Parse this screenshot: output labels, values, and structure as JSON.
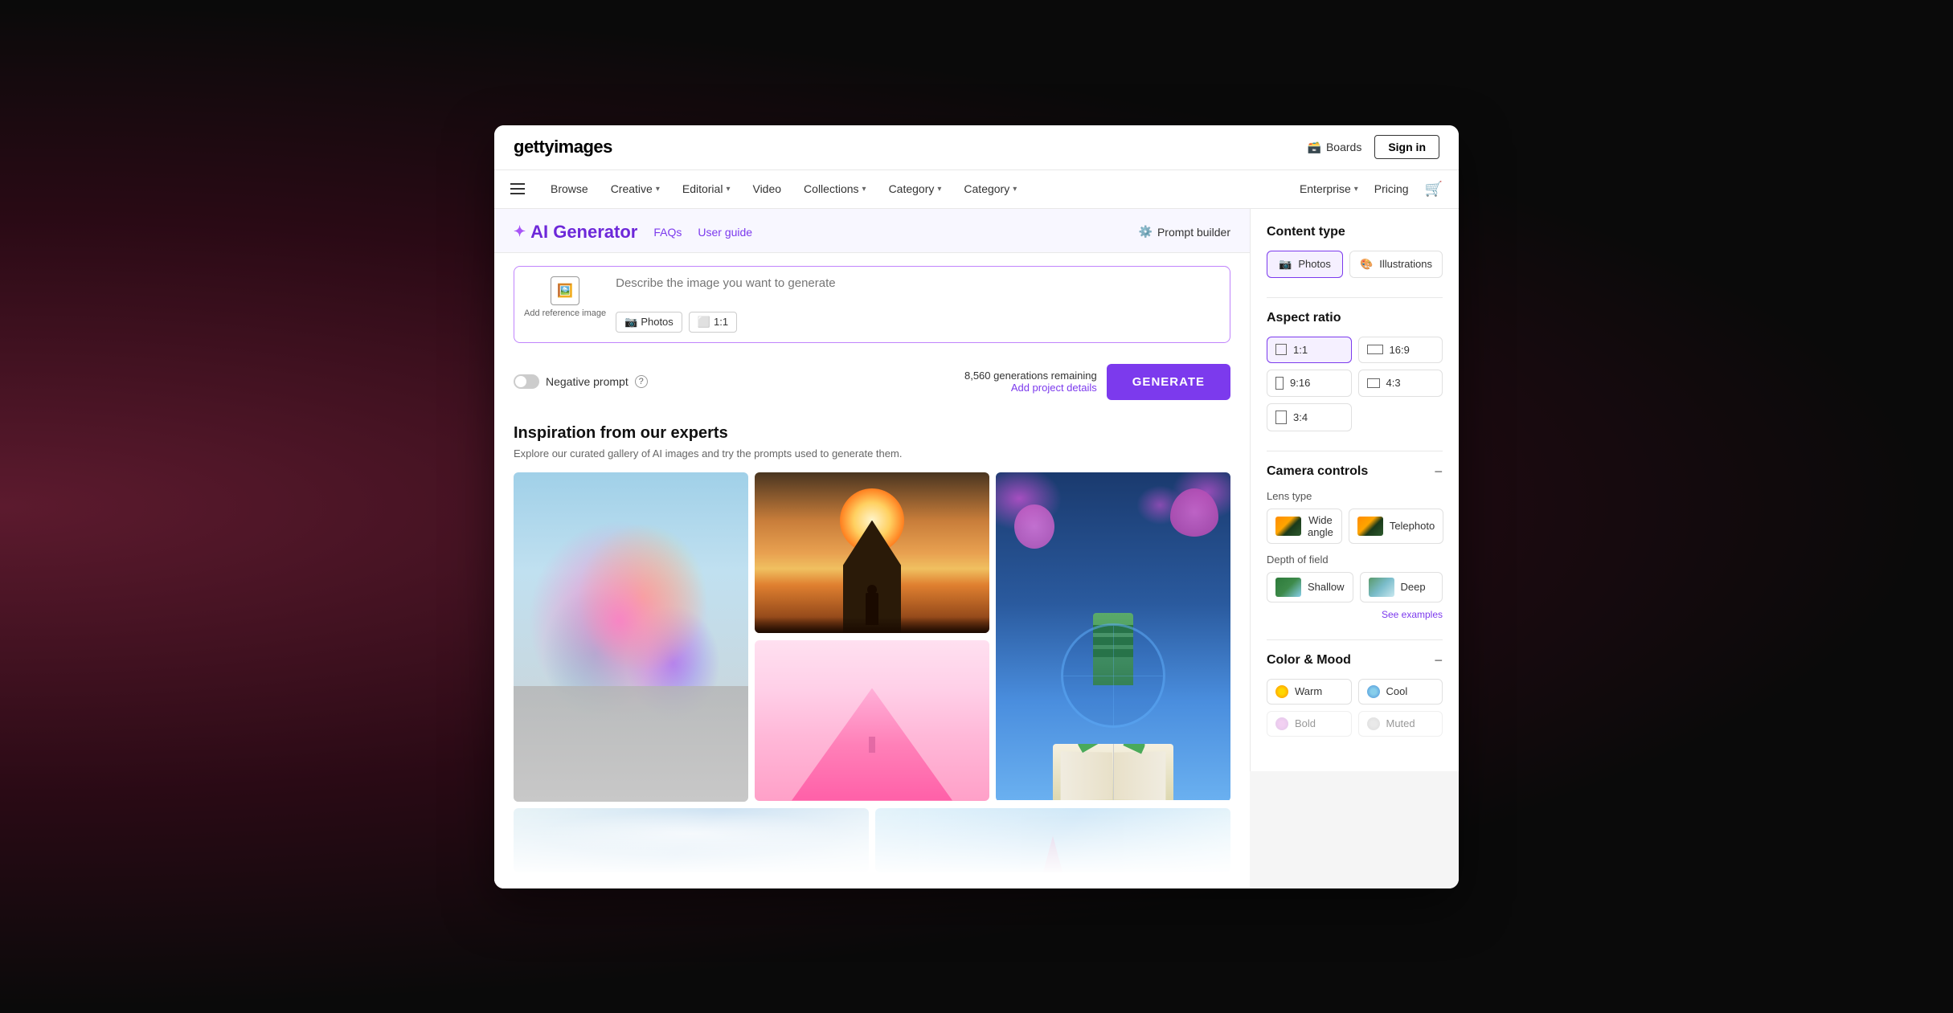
{
  "logo": {
    "part1": "getty",
    "part2": "images"
  },
  "nav_top": {
    "boards_label": "Boards",
    "sign_in_label": "Sign in"
  },
  "nav_secondary": {
    "browse": "Browse",
    "creative": "Creative",
    "editorial": "Editorial",
    "video": "Video",
    "collections": "Collections",
    "category1": "Category",
    "category2": "Category",
    "enterprise": "Enterprise",
    "pricing": "Pricing"
  },
  "ai_generator": {
    "title": "AI Generator",
    "star": "✦",
    "faqs": "FAQs",
    "user_guide": "User guide",
    "prompt_builder": "Prompt builder",
    "prompt_placeholder": "Describe the image you want to generate",
    "add_ref_label": "Add reference image",
    "tag_photos": "Photos",
    "tag_ratio": "1:1",
    "negative_prompt": "Negative prompt",
    "generations_remaining": "8,560 generations remaining",
    "add_project": "Add project details",
    "generate_btn": "GENERATE"
  },
  "gallery": {
    "title": "Inspiration from our experts",
    "subtitle": "Explore our curated gallery of AI images and try the prompts used to generate them."
  },
  "side_panel": {
    "content_type": {
      "title": "Content type",
      "photos": "Photos",
      "illustrations": "Illustrations"
    },
    "aspect_ratio": {
      "title": "Aspect ratio",
      "ratios": [
        "1:1",
        "16:9",
        "9:16",
        "4:3",
        "3:4"
      ]
    },
    "camera_controls": {
      "title": "Camera controls",
      "lens_type_label": "Lens type",
      "wide_angle": "Wide angle",
      "telephoto": "Telephoto",
      "depth_label": "Depth of field",
      "shallow": "Shallow",
      "deep": "Deep",
      "see_examples": "See examples"
    },
    "color_mood": {
      "title": "Color & Mood",
      "warm": "Warm",
      "cool": "Cool",
      "bold": "Bold",
      "muted": "Muted"
    }
  }
}
